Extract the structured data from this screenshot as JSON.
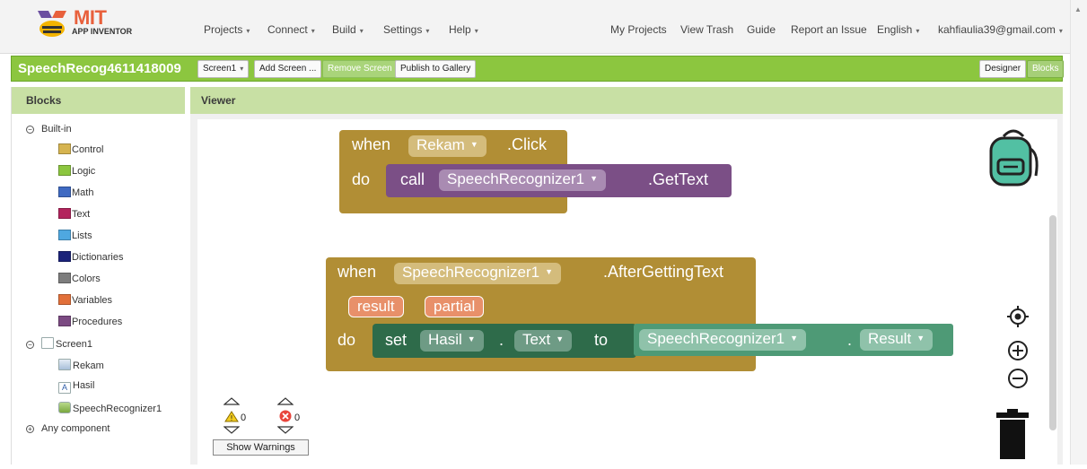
{
  "app": {
    "logo_text": "MIT",
    "logo_sub": "APP INVENTOR"
  },
  "topnav": {
    "left": [
      "Projects",
      "Connect",
      "Build",
      "Settings",
      "Help"
    ],
    "right": [
      "My Projects",
      "View Trash",
      "Guide",
      "Report an Issue",
      "English",
      "kahfiaulia39@gmail.com"
    ]
  },
  "project": {
    "name": "SpeechRecog4611418009",
    "screen_dropdown": "Screen1",
    "add_screen": "Add Screen ...",
    "remove_screen": "Remove Screen",
    "publish": "Publish to Gallery",
    "designer": "Designer",
    "blocks": "Blocks"
  },
  "blocks_panel": {
    "title": "Blocks",
    "builtin_label": "Built-in",
    "builtin": [
      {
        "label": "Control",
        "color": "#d6b450"
      },
      {
        "label": "Logic",
        "color": "#8cc63f"
      },
      {
        "label": "Math",
        "color": "#3f6ac2"
      },
      {
        "label": "Text",
        "color": "#b3245d"
      },
      {
        "label": "Lists",
        "color": "#4fa8e0"
      },
      {
        "label": "Dictionaries",
        "color": "#1b237a"
      },
      {
        "label": "Colors",
        "color": "#7d7d7d"
      },
      {
        "label": "Variables",
        "color": "#e2703a"
      },
      {
        "label": "Procedures",
        "color": "#7b4a82"
      }
    ],
    "screen_label": "Screen1",
    "components": [
      {
        "label": "Rekam",
        "icon": "button-icon"
      },
      {
        "label": "Hasil",
        "icon": "label-icon"
      },
      {
        "label": "SpeechRecognizer1",
        "icon": "speech-recognizer-icon"
      }
    ],
    "any_component": "Any component"
  },
  "viewer": {
    "title": "Viewer",
    "block1": {
      "when": "when",
      "component": "Rekam",
      "event": ".Click",
      "do": "do",
      "call": "call",
      "target": "SpeechRecognizer1",
      "method": ".GetText"
    },
    "block2": {
      "when": "when",
      "component": "SpeechRecognizer1",
      "event": ".AfterGettingText",
      "param1": "result",
      "param2": "partial",
      "do": "do",
      "set": "set",
      "set_component": "Hasil",
      "dot1": ".",
      "property": "Text",
      "to": "to",
      "getter_component": "SpeechRecognizer1",
      "dot2": ".",
      "getter_property": "Result"
    },
    "warnings_count": "0",
    "errors_count": "0",
    "show_warnings": "Show Warnings"
  }
}
